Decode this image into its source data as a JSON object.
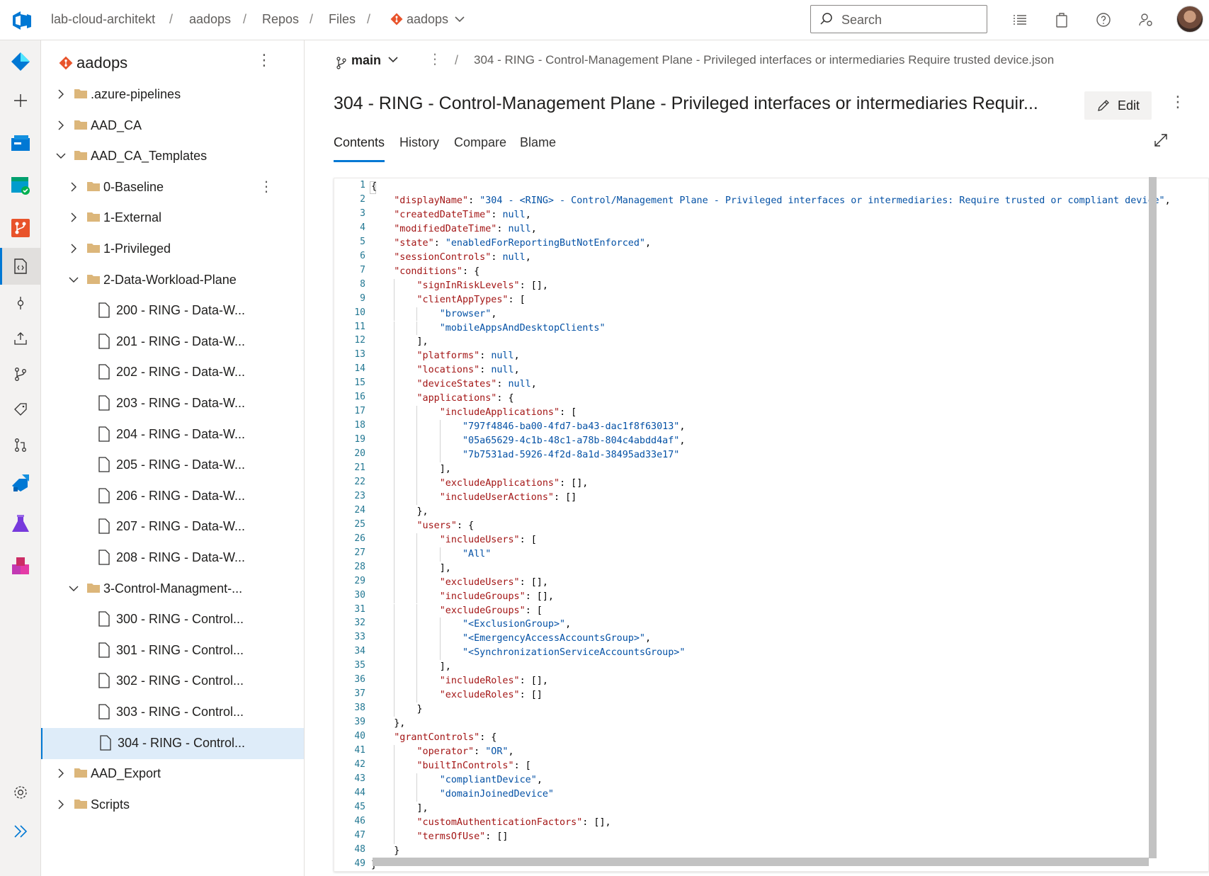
{
  "topbar": {
    "breadcrumbs": [
      "lab-cloud-architekt",
      "aadops",
      "Repos",
      "Files",
      "aadops"
    ],
    "search_placeholder": "Search"
  },
  "tree": {
    "repo": "aadops",
    "items": [
      {
        "label": ".azure-pipelines",
        "type": "folder",
        "state": "collapsed",
        "depth": 0
      },
      {
        "label": "AAD_CA",
        "type": "folder",
        "state": "collapsed",
        "depth": 0
      },
      {
        "label": "AAD_CA_Templates",
        "type": "folder",
        "state": "expanded",
        "depth": 0
      },
      {
        "label": "0-Baseline",
        "type": "folder",
        "state": "collapsed",
        "depth": 1
      },
      {
        "label": "1-External",
        "type": "folder",
        "state": "collapsed",
        "depth": 1
      },
      {
        "label": "1-Privileged",
        "type": "folder",
        "state": "collapsed",
        "depth": 1
      },
      {
        "label": "2-Data-Workload-Plane",
        "type": "folder",
        "state": "expanded",
        "depth": 1
      },
      {
        "label": "200 - RING - Data-W...",
        "type": "file",
        "depth": 2
      },
      {
        "label": "201 - RING - Data-W...",
        "type": "file",
        "depth": 2
      },
      {
        "label": "202 - RING - Data-W...",
        "type": "file",
        "depth": 2
      },
      {
        "label": "203 - RING - Data-W...",
        "type": "file",
        "depth": 2
      },
      {
        "label": "204 - RING - Data-W...",
        "type": "file",
        "depth": 2
      },
      {
        "label": "205 - RING - Data-W...",
        "type": "file",
        "depth": 2
      },
      {
        "label": "206 - RING - Data-W...",
        "type": "file",
        "depth": 2
      },
      {
        "label": "207 - RING - Data-W...",
        "type": "file",
        "depth": 2
      },
      {
        "label": "208 - RING - Data-W...",
        "type": "file",
        "depth": 2
      },
      {
        "label": "3-Control-Managment-...",
        "type": "folder",
        "state": "expanded",
        "depth": 1
      },
      {
        "label": "300 - RING - Control...",
        "type": "file",
        "depth": 2
      },
      {
        "label": "301 - RING - Control...",
        "type": "file",
        "depth": 2
      },
      {
        "label": "302 - RING - Control...",
        "type": "file",
        "depth": 2
      },
      {
        "label": "303 - RING - Control...",
        "type": "file",
        "depth": 2
      },
      {
        "label": "304 - RING - Control...",
        "type": "file",
        "depth": 2,
        "selected": true
      },
      {
        "label": "AAD_Export",
        "type": "folder",
        "state": "collapsed",
        "depth": 0
      },
      {
        "label": "Scripts",
        "type": "folder",
        "state": "collapsed",
        "depth": 0
      }
    ]
  },
  "main": {
    "branch": "main",
    "path": "304 - RING - Control-Management Plane - Privileged interfaces or intermediaries Require trusted device.json",
    "title": "304 - RING - Control-Management Plane - Privileged interfaces or intermediaries Requir...",
    "edit_label": "Edit",
    "tabs": [
      "Contents",
      "History",
      "Compare",
      "Blame"
    ],
    "active_tab": "Contents"
  },
  "code": {
    "lines": [
      [
        [
          "p",
          "{"
        ]
      ],
      [
        [
          "i",
          "    "
        ],
        [
          "k",
          "\"displayName\""
        ],
        [
          "p",
          ": "
        ],
        [
          "s",
          "\"304 - <RING> - Control/Management Plane - Privileged interfaces or intermediaries: Require trusted or compliant device\""
        ],
        [
          "p",
          ","
        ]
      ],
      [
        [
          "i",
          "    "
        ],
        [
          "k",
          "\"createdDateTime\""
        ],
        [
          "p",
          ": "
        ],
        [
          "n",
          "null"
        ],
        [
          "p",
          ","
        ]
      ],
      [
        [
          "i",
          "    "
        ],
        [
          "k",
          "\"modifiedDateTime\""
        ],
        [
          "p",
          ": "
        ],
        [
          "n",
          "null"
        ],
        [
          "p",
          ","
        ]
      ],
      [
        [
          "i",
          "    "
        ],
        [
          "k",
          "\"state\""
        ],
        [
          "p",
          ": "
        ],
        [
          "s",
          "\"enabledForReportingButNotEnforced\""
        ],
        [
          "p",
          ","
        ]
      ],
      [
        [
          "i",
          "    "
        ],
        [
          "k",
          "\"sessionControls\""
        ],
        [
          "p",
          ": "
        ],
        [
          "n",
          "null"
        ],
        [
          "p",
          ","
        ]
      ],
      [
        [
          "i",
          "    "
        ],
        [
          "k",
          "\"conditions\""
        ],
        [
          "p",
          ": {"
        ]
      ],
      [
        [
          "i",
          "        "
        ],
        [
          "k",
          "\"signInRiskLevels\""
        ],
        [
          "p",
          ": [],"
        ]
      ],
      [
        [
          "i",
          "        "
        ],
        [
          "k",
          "\"clientAppTypes\""
        ],
        [
          "p",
          ": ["
        ]
      ],
      [
        [
          "i",
          "            "
        ],
        [
          "s",
          "\"browser\""
        ],
        [
          "p",
          ","
        ]
      ],
      [
        [
          "i",
          "            "
        ],
        [
          "s",
          "\"mobileAppsAndDesktopClients\""
        ]
      ],
      [
        [
          "i",
          "        "
        ],
        [
          "p",
          "],"
        ]
      ],
      [
        [
          "i",
          "        "
        ],
        [
          "k",
          "\"platforms\""
        ],
        [
          "p",
          ": "
        ],
        [
          "n",
          "null"
        ],
        [
          "p",
          ","
        ]
      ],
      [
        [
          "i",
          "        "
        ],
        [
          "k",
          "\"locations\""
        ],
        [
          "p",
          ": "
        ],
        [
          "n",
          "null"
        ],
        [
          "p",
          ","
        ]
      ],
      [
        [
          "i",
          "        "
        ],
        [
          "k",
          "\"deviceStates\""
        ],
        [
          "p",
          ": "
        ],
        [
          "n",
          "null"
        ],
        [
          "p",
          ","
        ]
      ],
      [
        [
          "i",
          "        "
        ],
        [
          "k",
          "\"applications\""
        ],
        [
          "p",
          ": {"
        ]
      ],
      [
        [
          "i",
          "            "
        ],
        [
          "k",
          "\"includeApplications\""
        ],
        [
          "p",
          ": ["
        ]
      ],
      [
        [
          "i",
          "                "
        ],
        [
          "s",
          "\"797f4846-ba00-4fd7-ba43-dac1f8f63013\""
        ],
        [
          "p",
          ","
        ]
      ],
      [
        [
          "i",
          "                "
        ],
        [
          "s",
          "\"05a65629-4c1b-48c1-a78b-804c4abdd4af\""
        ],
        [
          "p",
          ","
        ]
      ],
      [
        [
          "i",
          "                "
        ],
        [
          "s",
          "\"7b7531ad-5926-4f2d-8a1d-38495ad33e17\""
        ]
      ],
      [
        [
          "i",
          "            "
        ],
        [
          "p",
          "],"
        ]
      ],
      [
        [
          "i",
          "            "
        ],
        [
          "k",
          "\"excludeApplications\""
        ],
        [
          "p",
          ": [],"
        ]
      ],
      [
        [
          "i",
          "            "
        ],
        [
          "k",
          "\"includeUserActions\""
        ],
        [
          "p",
          ": []"
        ]
      ],
      [
        [
          "i",
          "        "
        ],
        [
          "p",
          "},"
        ]
      ],
      [
        [
          "i",
          "        "
        ],
        [
          "k",
          "\"users\""
        ],
        [
          "p",
          ": {"
        ]
      ],
      [
        [
          "i",
          "            "
        ],
        [
          "k",
          "\"includeUsers\""
        ],
        [
          "p",
          ": ["
        ]
      ],
      [
        [
          "i",
          "                "
        ],
        [
          "s",
          "\"All\""
        ]
      ],
      [
        [
          "i",
          "            "
        ],
        [
          "p",
          "],"
        ]
      ],
      [
        [
          "i",
          "            "
        ],
        [
          "k",
          "\"excludeUsers\""
        ],
        [
          "p",
          ": [],"
        ]
      ],
      [
        [
          "i",
          "            "
        ],
        [
          "k",
          "\"includeGroups\""
        ],
        [
          "p",
          ": [],"
        ]
      ],
      [
        [
          "i",
          "            "
        ],
        [
          "k",
          "\"excludeGroups\""
        ],
        [
          "p",
          ": ["
        ]
      ],
      [
        [
          "i",
          "                "
        ],
        [
          "s",
          "\"<ExclusionGroup>\""
        ],
        [
          "p",
          ","
        ]
      ],
      [
        [
          "i",
          "                "
        ],
        [
          "s",
          "\"<EmergencyAccessAccountsGroup>\""
        ],
        [
          "p",
          ","
        ]
      ],
      [
        [
          "i",
          "                "
        ],
        [
          "s",
          "\"<SynchronizationServiceAccountsGroup>\""
        ]
      ],
      [
        [
          "i",
          "            "
        ],
        [
          "p",
          "],"
        ]
      ],
      [
        [
          "i",
          "            "
        ],
        [
          "k",
          "\"includeRoles\""
        ],
        [
          "p",
          ": [],"
        ]
      ],
      [
        [
          "i",
          "            "
        ],
        [
          "k",
          "\"excludeRoles\""
        ],
        [
          "p",
          ": []"
        ]
      ],
      [
        [
          "i",
          "        "
        ],
        [
          "p",
          "}"
        ]
      ],
      [
        [
          "i",
          "    "
        ],
        [
          "p",
          "},"
        ]
      ],
      [
        [
          "i",
          "    "
        ],
        [
          "k",
          "\"grantControls\""
        ],
        [
          "p",
          ": {"
        ]
      ],
      [
        [
          "i",
          "        "
        ],
        [
          "k",
          "\"operator\""
        ],
        [
          "p",
          ": "
        ],
        [
          "s",
          "\"OR\""
        ],
        [
          "p",
          ","
        ]
      ],
      [
        [
          "i",
          "        "
        ],
        [
          "k",
          "\"builtInControls\""
        ],
        [
          "p",
          ": ["
        ]
      ],
      [
        [
          "i",
          "            "
        ],
        [
          "s",
          "\"compliantDevice\""
        ],
        [
          "p",
          ","
        ]
      ],
      [
        [
          "i",
          "            "
        ],
        [
          "s",
          "\"domainJoinedDevice\""
        ]
      ],
      [
        [
          "i",
          "        "
        ],
        [
          "p",
          "],"
        ]
      ],
      [
        [
          "i",
          "        "
        ],
        [
          "k",
          "\"customAuthenticationFactors\""
        ],
        [
          "p",
          ": [],"
        ]
      ],
      [
        [
          "i",
          "        "
        ],
        [
          "k",
          "\"termsOfUse\""
        ],
        [
          "p",
          ": []"
        ]
      ],
      [
        [
          "i",
          "    "
        ],
        [
          "p",
          "}"
        ]
      ],
      [
        [
          "p",
          "}"
        ]
      ]
    ]
  },
  "colors": {
    "accent": "#0078d4",
    "json_key": "#a31515",
    "json_string": "#0451a5",
    "git_orange": "#e8532b"
  }
}
